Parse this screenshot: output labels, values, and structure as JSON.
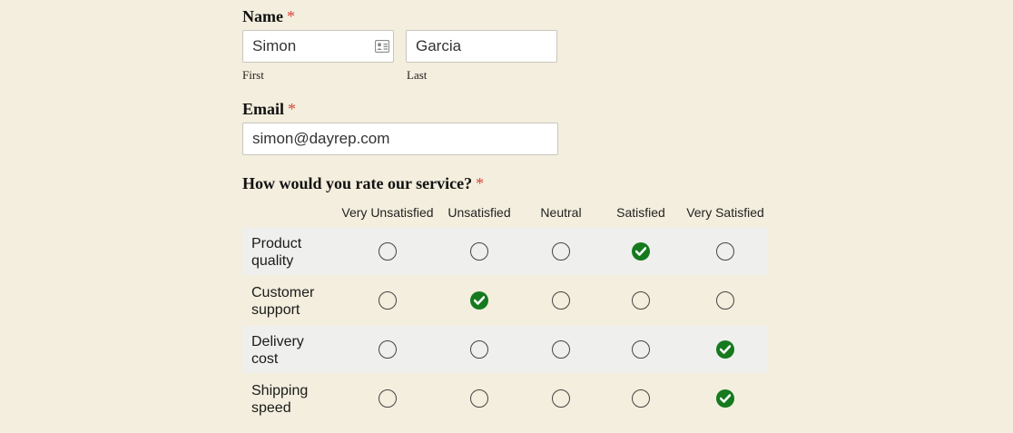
{
  "name_field": {
    "label": "Name",
    "required_mark": "*",
    "first": {
      "value": "Simon",
      "sublabel": "First",
      "icon": "contact-card-icon"
    },
    "last": {
      "value": "Garcia",
      "sublabel": "Last"
    }
  },
  "email_field": {
    "label": "Email",
    "required_mark": "*",
    "value": "simon@dayrep.com"
  },
  "rating": {
    "question": "How would you rate our service?",
    "required_mark": "*",
    "columns": [
      "Very Unsatisfied",
      "Unsatisfied",
      "Neutral",
      "Satisfied",
      "Very Satisfied"
    ],
    "rows": [
      {
        "label": "Product quality",
        "selected": "Satisfied"
      },
      {
        "label": "Customer support",
        "selected": "Unsatisfied"
      },
      {
        "label": "Delivery cost",
        "selected": "Very Satisfied"
      },
      {
        "label": "Shipping speed",
        "selected": "Very Satisfied"
      }
    ]
  },
  "colors": {
    "background": "#f3eedd",
    "required": "#d9463b",
    "checked": "#157a1e",
    "row_shade": "#efefee"
  }
}
